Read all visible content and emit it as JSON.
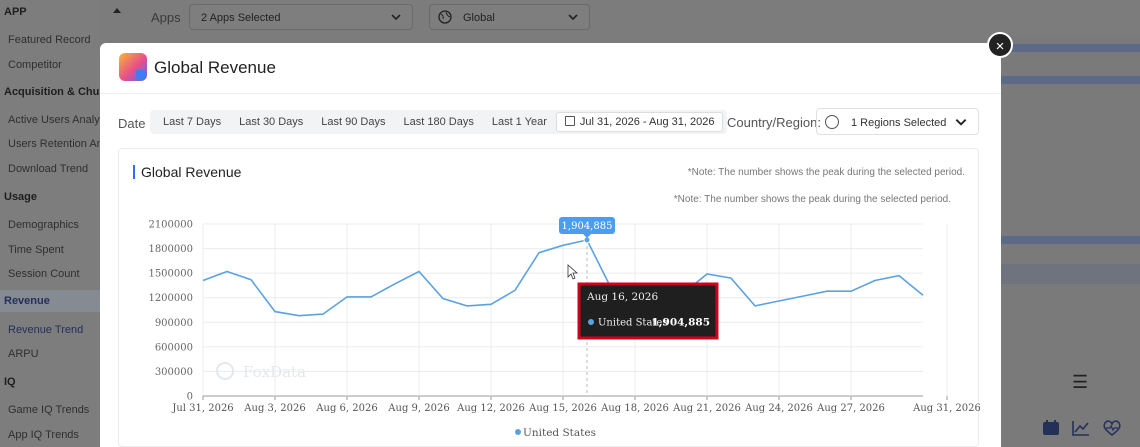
{
  "sidebar": {
    "sections": [
      {
        "title": "APP",
        "items": [
          "Featured Record",
          "Competitor"
        ]
      },
      {
        "title": "Acquisition & Churn",
        "items": [
          "Active Users Analysis",
          "Users Retention Analysis",
          "Download Trend"
        ]
      },
      {
        "title": "Usage",
        "items": [
          "Demographics",
          "Time Spent",
          "Session Count"
        ]
      },
      {
        "title": "Revenue",
        "items": [
          "Revenue Trend",
          "ARPU"
        ]
      },
      {
        "title": "IQ",
        "items": [
          "Game IQ Trends",
          "App IQ Trends"
        ]
      }
    ],
    "collapse_icon": "caret-up-icon"
  },
  "topbar": {
    "apps_label": "Apps",
    "apps_value": "2 Apps Selected",
    "region_value": "Global"
  },
  "modal": {
    "title": "Global Revenue",
    "close_label": "×",
    "date_label": "Date",
    "ranges": [
      "Last 7 Days",
      "Last 30 Days",
      "Last 90 Days",
      "Last 180 Days",
      "Last 1 Year"
    ],
    "active_range": "Jul 31, 2026 - Aug 31, 2026",
    "country_label": "Country/Region:",
    "region_selected": "1 Regions Selected",
    "card_title": "Global Revenue",
    "note": "*Note: The number shows the peak during the selected period.",
    "watermark": "FoxData"
  },
  "colors": {
    "line": "#5ba3e0",
    "accent": "#2f6bff",
    "tooltip_bg": "#1f1f1f",
    "tooltip_border": "#d0021b",
    "peak_badge": "#4a9df0"
  },
  "chart_data": {
    "type": "line",
    "series": [
      {
        "name": "United States",
        "values": [
          1410000,
          1520000,
          1420000,
          1030000,
          980000,
          1000000,
          1210000,
          1210000,
          1370000,
          1520000,
          1190000,
          1100000,
          1120000,
          1290000,
          1750000,
          1840000,
          1904885,
          1320000,
          1200000,
          1120000,
          1250000,
          1490000,
          1440000,
          1100000,
          1160000,
          1220000,
          1280000,
          1280000,
          1410000,
          1470000,
          1230000
        ]
      }
    ],
    "x_ticks": [
      "Jul 31, 2026",
      "Aug 3, 2026",
      "Aug 6, 2026",
      "Aug 9, 2026",
      "Aug 12, 2026",
      "Aug 15, 2026",
      "Aug 18, 2026",
      "Aug 21, 2026",
      "Aug 24, 2026",
      "Aug 27, 2026",
      "Aug 31, 2026"
    ],
    "x_tick_index": [
      0,
      3,
      6,
      9,
      12,
      15,
      18,
      21,
      24,
      27,
      31
    ],
    "y_ticks": [
      "0",
      "300000",
      "600000",
      "900000",
      "1200000",
      "1500000",
      "1800000",
      "2100000"
    ],
    "ylim": [
      0,
      2100000
    ],
    "peak_label": "1,904,885",
    "peak_index": 16,
    "tooltip": {
      "date": "Aug 16, 2026",
      "series": "United States",
      "value": "1,904,885"
    },
    "legend": "United States",
    "grid": true,
    "legend_position": "bottom"
  }
}
